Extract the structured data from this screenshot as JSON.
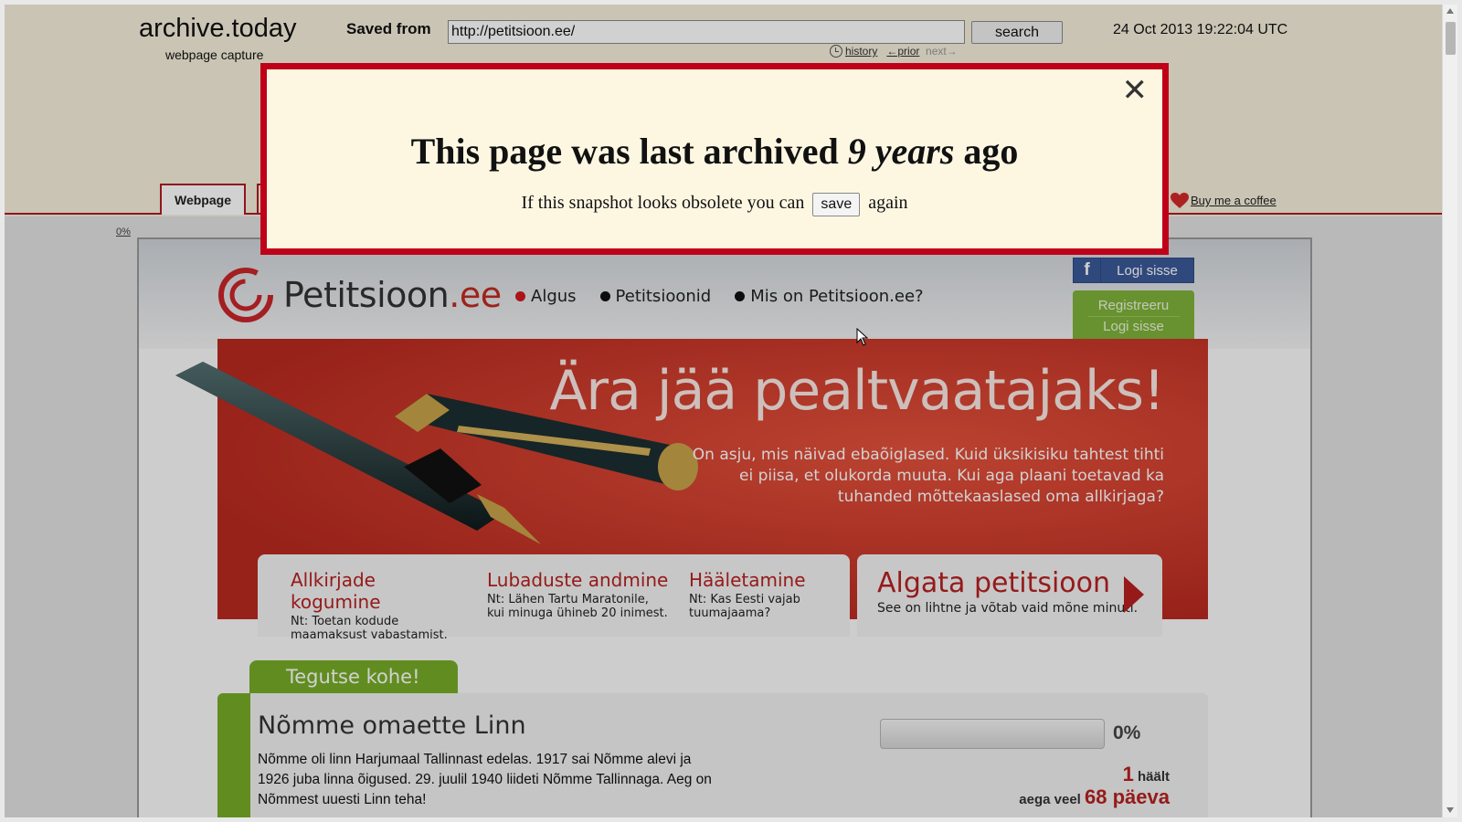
{
  "archive": {
    "logo": "archive.today",
    "logo_sub": "webpage capture",
    "saved_from_label": "Saved from",
    "url_value": "http://petitsioon.ee/",
    "search_label": "search",
    "capture_date": "24 Oct 2013 19:22:04 UTC",
    "history_label": "history",
    "prior_label": "←prior",
    "next_label": "next→",
    "tab_webpage": "Webpage",
    "coffee_label": "Buy me a coffee",
    "scroll_percent": "0%"
  },
  "modal": {
    "title_prefix": "This page was last archived",
    "title_emphasis": "9 years",
    "title_suffix": "ago",
    "text_prefix": "If this snapshot looks obsolete you can",
    "save_label": "save",
    "text_suffix": "again",
    "close_glyph": "✕"
  },
  "site": {
    "logo_main": "Petitsioon",
    "logo_ext": ".ee",
    "nav": [
      "Algus",
      "Petitsioonid",
      "Mis on Petitsioon.ee?"
    ],
    "fb_icon": "f",
    "fb_login": "Logi sisse",
    "register": "Registreeru",
    "login": "Logi sisse",
    "banner_title": "Ära jää pealtvaatajaks!",
    "banner_text": "On asju, mis näivad ebaõiglased. Kuid üksikisiku tahtest tihti ei piisa, et olukorda muuta. Kui aga plaani toetavad ka tuhanded mõttekaaslased oma allkirjaga?",
    "features": [
      {
        "title": "Allkirjade kogumine",
        "desc": "Nt: Toetan kodude maamaksust vabastamist."
      },
      {
        "title": "Lubaduste andmine",
        "desc": "Nt: Lähen Tartu Maratonile, kui minuga ühineb 20 inimest."
      },
      {
        "title": "Hääletamine",
        "desc": "Nt: Kas Eesti vajab tuumajaama?"
      }
    ],
    "start_title": "Algata petitsioon",
    "start_desc": "See on lihtne ja võtab vaid mõne minuti.",
    "act_tab": "Tegutse kohe!",
    "petition_title": "Nõmme omaette Linn",
    "petition_desc": "Nõmme oli linn Harjumaal Tallinnast edelas. 1917 sai Nõmme alevi ja 1926 juba linna õigused. 29. juulil 1940 liideti Nõmme Tallinnaga. Aeg on Nõmmest uuesti Linn teha!",
    "progress_fraction": 0,
    "progress_label": "0%",
    "votes_count": "1",
    "votes_label": "häält",
    "days_prefix": "aega veel",
    "days_value": "68 päeva"
  },
  "colors": {
    "accent": "#c00018",
    "green": "#77ac28",
    "facebook": "#3b5998"
  }
}
